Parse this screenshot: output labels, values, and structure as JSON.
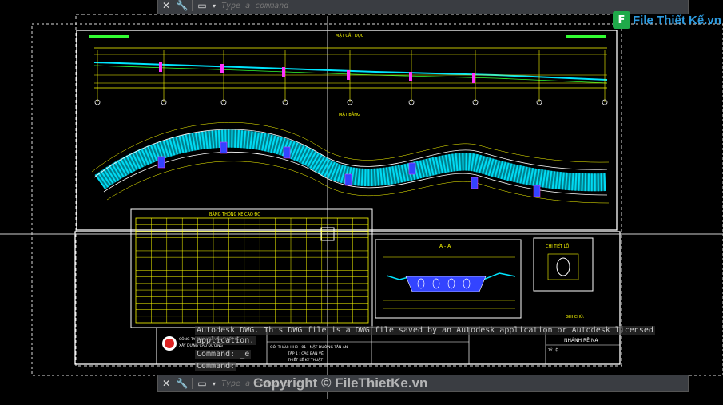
{
  "command_bar_top": {
    "placeholder": "Type a command"
  },
  "command_bar_bottom": {
    "placeholder": "Type a command"
  },
  "command_history": {
    "line1": "Autodesk DWG.  This DWG file is a DWG file saved by an Autodesk application or Autodesk licensed",
    "line2": "application.",
    "line3": "Command: _e",
    "line4": "Command:"
  },
  "drawing": {
    "profile_title": "MẶT CẮT DỌC",
    "plan_title": "MẶT BẰNG",
    "table_title": "BẢNG THỐNG KÊ CAO ĐỘ",
    "section_title": "A - A",
    "detail_title": "CHI TIẾT LỖ",
    "notes_title": "GHI CHÚ:",
    "company_line1": "CÔNG TY TNHH TƯ VẤN THIẾT KẾ",
    "company_line2": "XÂY DỰNG CẦU ĐƯỜNG",
    "project_line": "GÓI THẦU: HH8 - 01 - MẶT ĐƯỜNG TÂN AN",
    "volume_line": "TẬP 1 : CÁC BẢN VẼ",
    "design_line": "THIẾT KẾ KỸ THUẬT",
    "sheet_name": "NHÁNH RẼ NA",
    "scale_label": "TỶ LỆ"
  },
  "watermark": {
    "text": "Copyright © FileThietKe.vn"
  },
  "logo": {
    "badge": "F",
    "text": "File Thiết Kế.vn"
  },
  "colors": {
    "background": "#000000",
    "cad_white": "#ffffff",
    "cad_yellow": "#ffff00",
    "cad_cyan": "#00e5ff",
    "cad_green": "#33ff33",
    "cad_magenta": "#ff33ff",
    "cad_red": "#ff3333"
  },
  "icons": [
    "close-icon",
    "wrench-icon",
    "command-prompt-icon",
    "chevron-down-icon"
  ]
}
